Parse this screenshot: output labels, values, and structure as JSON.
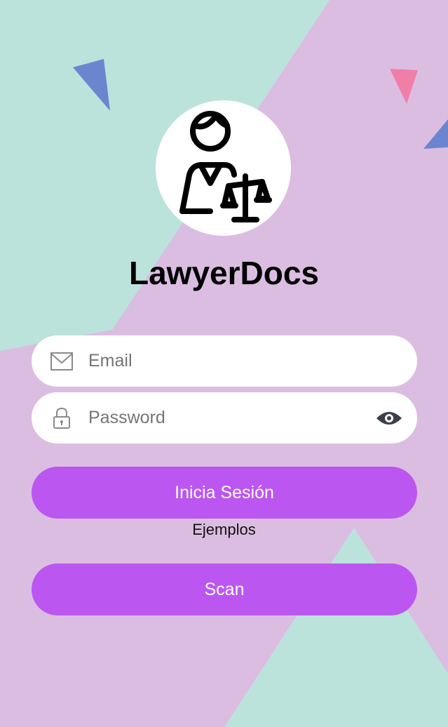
{
  "app": {
    "title": "LawyerDocs"
  },
  "form": {
    "email_placeholder": "Email",
    "password_placeholder": "Password"
  },
  "buttons": {
    "login_label": "Inicia Sesión",
    "scan_label": "Scan"
  },
  "links": {
    "examples_label": "Ejemplos"
  },
  "icons": {
    "logo": "lawyer-with-scales-icon",
    "email": "envelope-icon",
    "password": "lock-icon",
    "visibility": "eye-icon"
  },
  "colors": {
    "accent_button": "#bb56f1",
    "background_mint": "#bce2dc",
    "background_lilac": "#dbbde2",
    "field_background": "#ffffff"
  }
}
